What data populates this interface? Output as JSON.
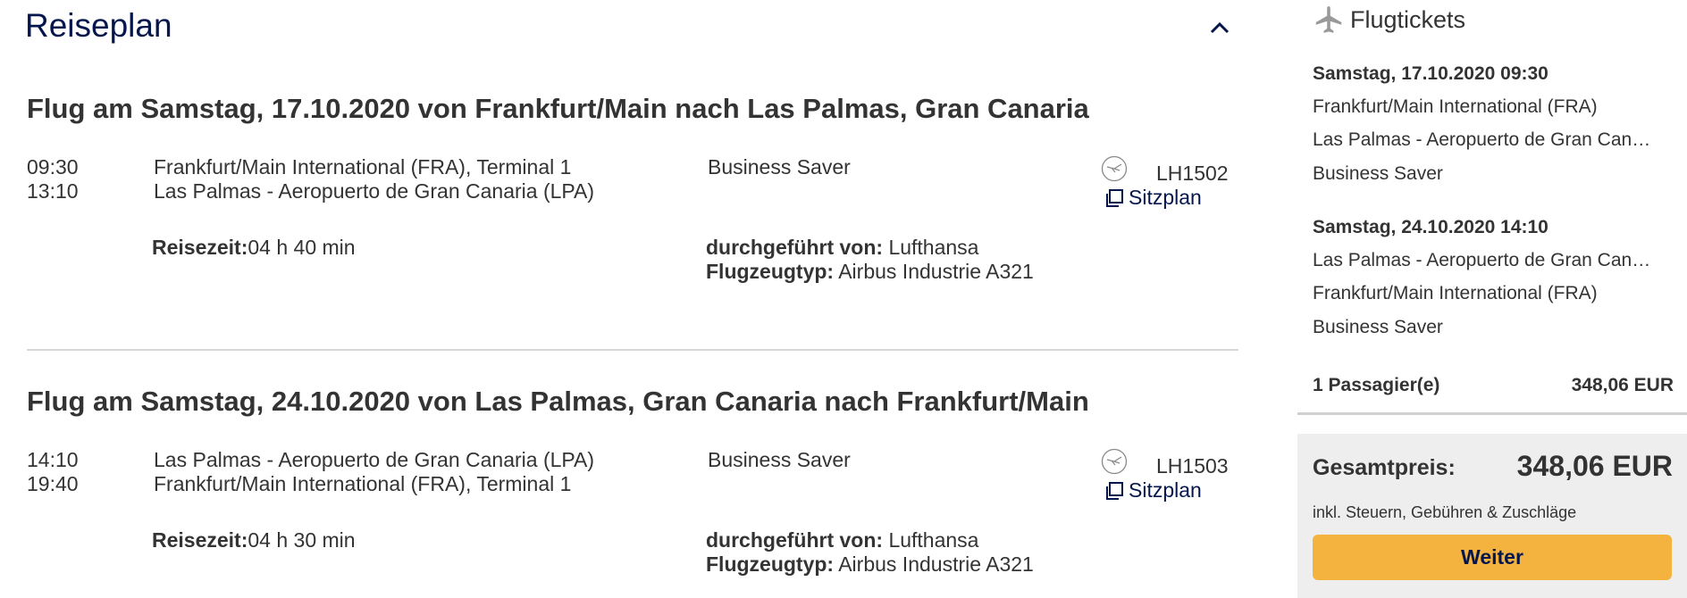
{
  "reiseplan": {
    "title": "Reiseplan"
  },
  "flights": [
    {
      "heading": "Flug am Samstag, 17.10.2020 von Frankfurt/Main nach Las Palmas, Gran Canaria",
      "dep_time": "09:30",
      "arr_time": "13:10",
      "dep_airport": "Frankfurt/Main International (FRA), Terminal 1",
      "arr_airport": "Las Palmas - Aeropuerto de Gran Canaria (LPA)",
      "fare": "Business Saver",
      "flight_number": "LH1502",
      "seatmap_label": "Sitzplan",
      "duration_label": "Reisezeit:",
      "duration": "04 h 40 min",
      "operated_label": "durchgeführt von:",
      "operated": "Lufthansa",
      "aircraft_label": "Flugzeugtyp:",
      "aircraft": "Airbus Industrie A321"
    },
    {
      "heading": "Flug am Samstag, 24.10.2020 von Las Palmas, Gran Canaria nach Frankfurt/Main",
      "dep_time": "14:10",
      "arr_time": "19:40",
      "dep_airport": "Las Palmas - Aeropuerto de Gran Canaria (LPA)",
      "arr_airport": "Frankfurt/Main International (FRA), Terminal 1",
      "fare": "Business Saver",
      "flight_number": "LH1503",
      "seatmap_label": "Sitzplan",
      "duration_label": "Reisezeit:",
      "duration": "04 h 30 min",
      "operated_label": "durchgeführt von:",
      "operated": "Lufthansa",
      "aircraft_label": "Flugzeugtyp:",
      "aircraft": "Airbus Industrie A321"
    }
  ],
  "sidebar": {
    "title": "Flugtickets",
    "segments": [
      {
        "date": "Samstag, 17.10.2020 09:30",
        "from": "Frankfurt/Main International (FRA)",
        "to": "Las Palmas - Aeropuerto de Gran Can…",
        "fare": "Business Saver"
      },
      {
        "date": "Samstag, 24.10.2020 14:10",
        "from": "Las Palmas - Aeropuerto de Gran Can…",
        "to": "Frankfurt/Main International (FRA)",
        "fare": "Business Saver"
      }
    ],
    "passengers_label": "1 Passagier(e)",
    "passengers_price": "348,06 EUR",
    "total_label": "Gesamtpreis:",
    "total_value": "348,06 EUR",
    "total_note": "inkl. Steuern, Gebühren & Zuschläge",
    "continue_label": "Weiter"
  },
  "colors": {
    "brand_navy": "#05164d",
    "button_yellow": "#f4b23e",
    "text": "#333333",
    "panel_gray": "#eeeeee"
  },
  "icons": {
    "collapse": "chevron-up-icon",
    "airline": "lufthansa-crane-icon",
    "seatmap": "seatmap-icon",
    "tickets": "airplane-icon"
  }
}
